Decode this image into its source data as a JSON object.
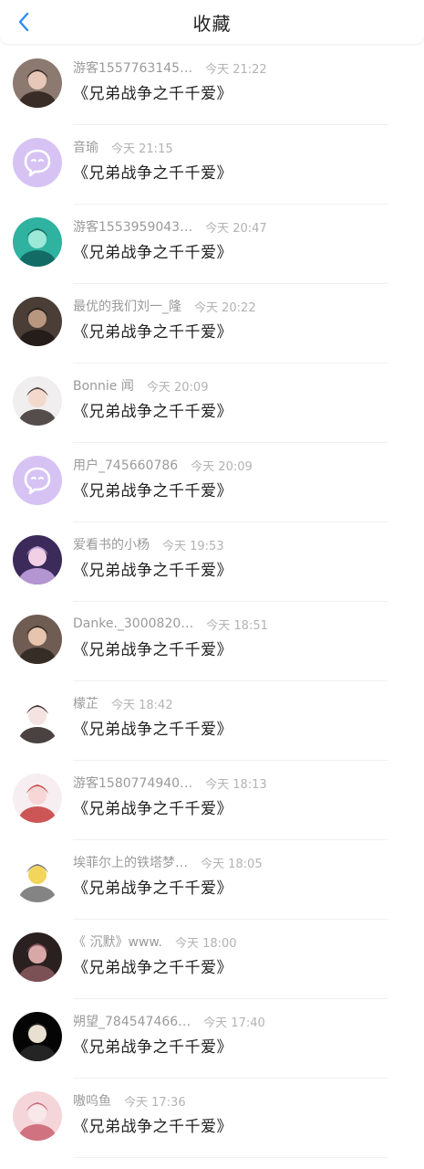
{
  "header": {
    "title": "收藏"
  },
  "items": [
    {
      "name": "游客1557763145…",
      "time": "今天 21:22",
      "book": "《兄弟战争之千千爱》",
      "avatar": "photo-girl"
    },
    {
      "name": "音瑜",
      "time": "今天 21:15",
      "book": "《兄弟战争之千千爱》",
      "avatar": "default-chat"
    },
    {
      "name": "游客1553959043…",
      "time": "今天 20:47",
      "book": "《兄弟战争之千千爱》",
      "avatar": "photo-teal"
    },
    {
      "name": "最优的我们刘一_隆",
      "time": "今天 20:22",
      "book": "《兄弟战争之千千爱》",
      "avatar": "photo-dark"
    },
    {
      "name": "Bonnie 闻",
      "time": "今天 20:09",
      "book": "《兄弟战争之千千爱》",
      "avatar": "photo-child"
    },
    {
      "name": "用户_745660786",
      "time": "今天 20:09",
      "book": "《兄弟战争之千千爱》",
      "avatar": "default-chat"
    },
    {
      "name": "爱看书的小杨",
      "time": "今天 19:53",
      "book": "《兄弟战争之千千爱》",
      "avatar": "photo-anime"
    },
    {
      "name": "Danke._3000820…",
      "time": "今天 18:51",
      "book": "《兄弟战争之千千爱》",
      "avatar": "photo-baby"
    },
    {
      "name": "檬芷",
      "time": "今天 18:42",
      "book": "《兄弟战争之千千爱》",
      "avatar": "photo-drawing"
    },
    {
      "name": "游客1580774940…",
      "time": "今天 18:13",
      "book": "《兄弟战争之千千爱》",
      "avatar": "photo-flower"
    },
    {
      "name": "埃菲尔上的铁塔梦…",
      "time": "今天 18:05",
      "book": "《兄弟战争之千千爱》",
      "avatar": "photo-sketch"
    },
    {
      "name": "《 沉默》www.",
      "time": "今天 18:00",
      "book": "《兄弟战争之千千爱》",
      "avatar": "photo-night"
    },
    {
      "name": "朔望_784547466…",
      "time": "今天 17:40",
      "book": "《兄弟战争之千千爱》",
      "avatar": "photo-black"
    },
    {
      "name": "嗷呜鱼",
      "time": "今天 17:36",
      "book": "《兄弟战争之千千爱》",
      "avatar": "photo-pink"
    }
  ],
  "colors": {
    "accent": "#2f8cf5",
    "default_avatar": "#d6c3f4"
  }
}
